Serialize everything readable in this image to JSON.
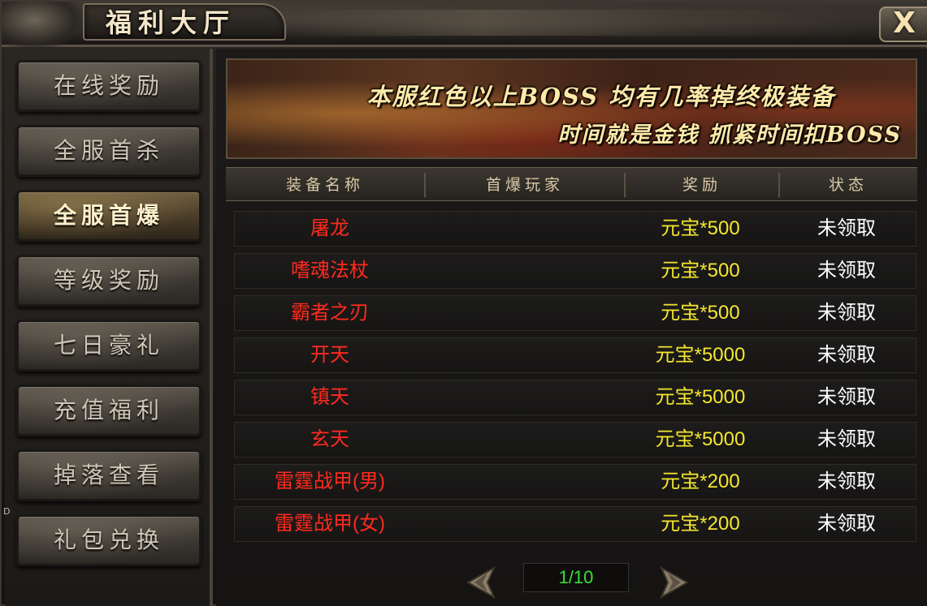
{
  "window": {
    "title": "福利大厅",
    "close_label": "X"
  },
  "sidebar": {
    "items": [
      {
        "label": "在线奖励",
        "active": false
      },
      {
        "label": "全服首杀",
        "active": false
      },
      {
        "label": "全服首爆",
        "active": true
      },
      {
        "label": "等级奖励",
        "active": false
      },
      {
        "label": "七日豪礼",
        "active": false
      },
      {
        "label": "充值福利",
        "active": false
      },
      {
        "label": "掉落查看",
        "active": false
      },
      {
        "label": "礼包兑换",
        "active": false
      }
    ]
  },
  "banner": {
    "line1": "本服红色以上BOSS 均有几率掉终极装备",
    "line2": "时间就是金钱  抓紧时间扣BOSS"
  },
  "table": {
    "columns": [
      "装备名称",
      "首爆玩家",
      "奖励",
      "状态"
    ],
    "rows": [
      {
        "name": "屠龙",
        "player": "",
        "reward": "元宝*500",
        "status": "未领取"
      },
      {
        "name": "嗜魂法杖",
        "player": "",
        "reward": "元宝*500",
        "status": "未领取"
      },
      {
        "name": "霸者之刃",
        "player": "",
        "reward": "元宝*500",
        "status": "未领取"
      },
      {
        "name": "开天",
        "player": "",
        "reward": "元宝*5000",
        "status": "未领取"
      },
      {
        "name": "镇天",
        "player": "",
        "reward": "元宝*5000",
        "status": "未领取"
      },
      {
        "name": "玄天",
        "player": "",
        "reward": "元宝*5000",
        "status": "未领取"
      },
      {
        "name": "雷霆战甲(男)",
        "player": "",
        "reward": "元宝*200",
        "status": "未领取"
      },
      {
        "name": "雷霆战甲(女)",
        "player": "",
        "reward": "元宝*200",
        "status": "未领取"
      }
    ]
  },
  "pager": {
    "page_text": "1/10",
    "prev_icon": "arrow-left-icon",
    "next_icon": "arrow-right-icon"
  },
  "edge_mark": "D",
  "colors": {
    "item_name": "#ff2a1e",
    "reward": "#f5e72e",
    "status": "#ffffff",
    "page": "#38e03a"
  }
}
